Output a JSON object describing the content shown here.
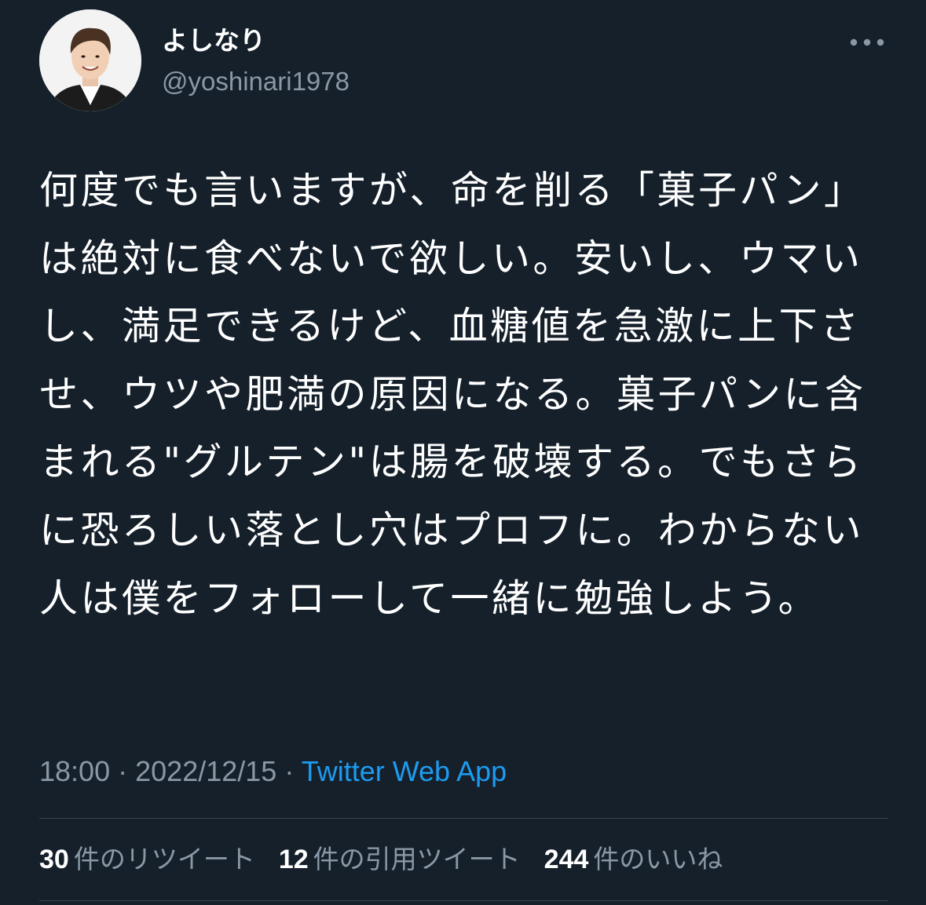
{
  "author": {
    "display_name": "よしなり",
    "handle": "@yoshinari1978"
  },
  "icons": {
    "avatar": "profile-photo",
    "more": "more-horizontal-icon"
  },
  "tweet": {
    "text": "何度でも言いますが、命を削る「菓子パン」は絶対に食べないで欲しい。安いし、ウマいし、満足できるけど、血糖値を急激に上下させ、ウツや肥満の原因になる。菓子パンに含まれる\"グルテン\"は腸を破壊する。でもさらに恐ろしい落とし穴はプロフに。わからない人は僕をフォローして一緒に勉強しよう。",
    "time": "18:00",
    "separator": "·",
    "date": "2022/12/15",
    "source": "Twitter Web App"
  },
  "stats": [
    {
      "count": "30",
      "label": "件のリツイート"
    },
    {
      "count": "12",
      "label": "件の引用ツイート"
    },
    {
      "count": "244",
      "label": "件のいいね"
    }
  ],
  "colors": {
    "background": "#15202b",
    "text": "#ffffff",
    "secondary": "#8b98a5",
    "link": "#1d9bf0",
    "divider": "#38444d"
  }
}
